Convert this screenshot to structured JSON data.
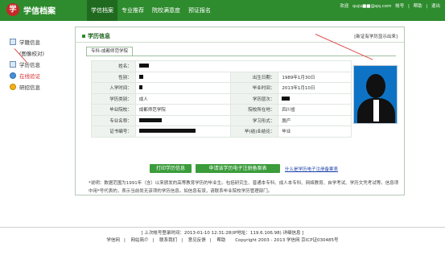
{
  "header": {
    "logo_text": "学信档案",
    "logo_mark": "学",
    "nav": [
      "学信档案",
      "专业推荐",
      "院校满意度",
      "预证报名"
    ],
    "welcome_prefix": "欢迎",
    "username": "quju■■@qq.com",
    "account": "帐号",
    "help": "帮助",
    "logout": "退出"
  },
  "sidebar": {
    "items": [
      {
        "label": "学籍信息",
        "sub": "(图像校对)",
        "icon": "doc-icon"
      },
      {
        "label": "学历信息",
        "icon": "doc-icon"
      },
      {
        "label": "在线验证",
        "icon": "check-icon"
      },
      {
        "label": "研招信息",
        "icon": "gear-icon"
      }
    ]
  },
  "panel": {
    "title": "学历信息",
    "link": "[新证有学历显示出来]",
    "tab": "专科-成都师范学院"
  },
  "rows": [
    {
      "l1": "姓名：",
      "v1": "",
      "l2": "",
      "v2": ""
    },
    {
      "l1": "性别：",
      "v1": "",
      "l2": "出生日期：",
      "v2": "1989年1月30日"
    },
    {
      "l1": "入学时间：",
      "v1": "",
      "l2": "毕业时间：",
      "v2": "2013年1月10日"
    },
    {
      "l1": "学历类别：",
      "v1": "成人",
      "l2": "学历层次：",
      "v2": ""
    },
    {
      "l1": "毕业院校：",
      "v1": "成都师范学院",
      "l2": "院校所在地：",
      "v2": "四川省"
    },
    {
      "l1": "专业名称：",
      "v1": "",
      "l2": "学习形式：",
      "v2": "脱产"
    },
    {
      "l1": "证书编号：",
      "v1": "",
      "l2": "毕(结)业结论：",
      "v2": "毕业"
    }
  ],
  "buttons": {
    "print": "打印学历信息",
    "apply": "申请该学历电子注册备案表",
    "what": "什么是学历电子注册备案表"
  },
  "note": "*说明：数据范围为1991年（含）以来颁发的高等教育学历的毕业生。包括研究生、普通本专科、成人本专科、网络教育、自学考试、学历文凭考试等。信息项中用*号代表的，表示当前尚无该项的学历信息。如信息有误，请联系毕业院校学历管理部门。",
  "footer": {
    "last_login": "[ 上次帐号登录时间：2013-01-10 12:31:28(IP地址：119.6.106.98)  详细信息 ]",
    "links": [
      "学信网",
      "网站简介",
      "联系我们",
      "意见反馈",
      "帮助",
      "Copyright 2003 - 2013 学信网 京ICP证030485号"
    ]
  }
}
